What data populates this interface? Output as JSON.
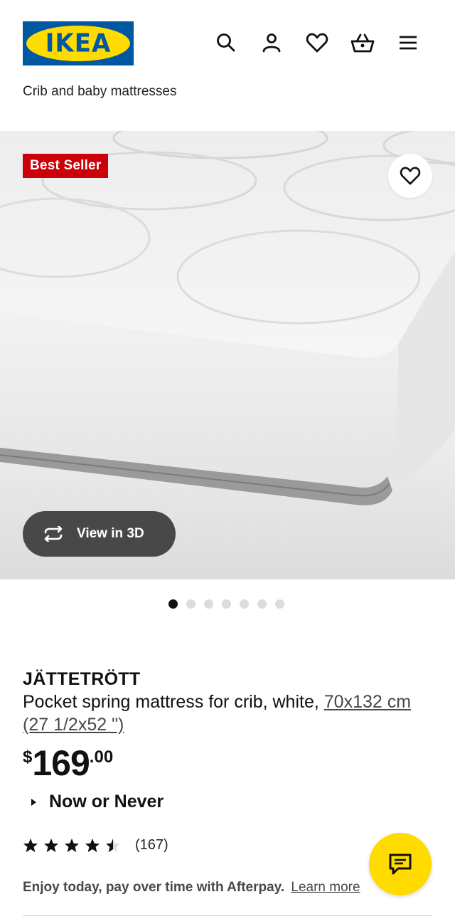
{
  "header": {
    "logo_text": "IKEA",
    "icons": [
      "search-icon",
      "user-icon",
      "heart-icon",
      "shopping-bag-icon",
      "hamburger-menu-icon"
    ]
  },
  "breadcrumb": "Crib and baby mattresses",
  "hero": {
    "badge": "Best Seller",
    "view_3d_label": "View in 3D",
    "carousel_dots": 7,
    "active_dot": 0
  },
  "product": {
    "name": "JÄTTETRÖTT",
    "description": "Pocket spring mattress for crib, white,",
    "size_link": "70x132 cm (27 1/2x52 \")",
    "price": {
      "currency": "$",
      "integer": "169",
      "decimal": ".00"
    },
    "promo": "Now or Never",
    "rating": {
      "stars": 4.5,
      "count": "(167)"
    },
    "afterpay_text": "Enjoy today, pay over time with Afterpay.",
    "afterpay_link": "Learn more"
  },
  "colors": {
    "brand_blue": "#0058a3",
    "brand_yellow": "#ffdb00",
    "badge_red": "#cc0008"
  }
}
